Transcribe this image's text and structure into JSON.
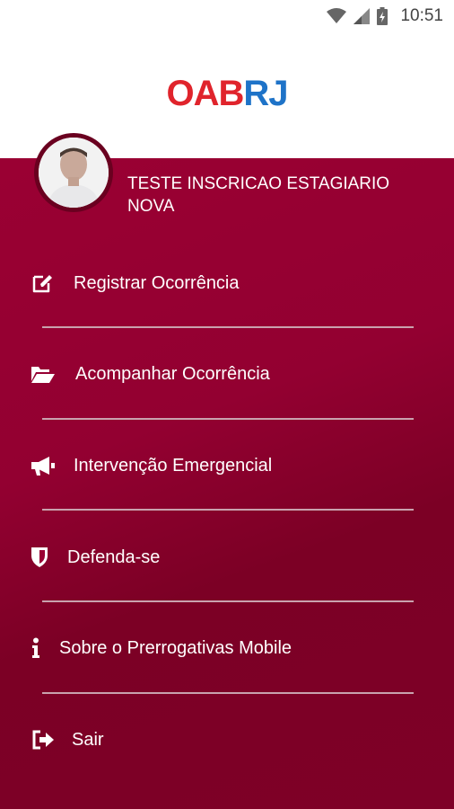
{
  "status_bar": {
    "time": "10:51",
    "icons": [
      "wifi-icon",
      "cell-signal-icon",
      "battery-charging-icon"
    ]
  },
  "header": {
    "logo_part1": "OAB",
    "logo_part2": "RJ",
    "colors": {
      "oab": "#e0242c",
      "rj": "#1e73c8"
    }
  },
  "drawer": {
    "background": "#930031",
    "user": {
      "name": "TESTE INSCRICAO ESTAGIARIO NOVA"
    },
    "menu": [
      {
        "label": "Registrar Ocorrência",
        "icon": "edit-icon"
      },
      {
        "label": "Acompanhar Ocorrência",
        "icon": "folder-open-icon"
      },
      {
        "label": "Intervenção Emergencial",
        "icon": "megaphone-icon"
      },
      {
        "label": "Defenda-se",
        "icon": "shield-icon"
      },
      {
        "label": "Sobre o Prerrogativas Mobile",
        "icon": "info-icon"
      },
      {
        "label": "Sair",
        "icon": "sign-out-icon"
      }
    ]
  }
}
